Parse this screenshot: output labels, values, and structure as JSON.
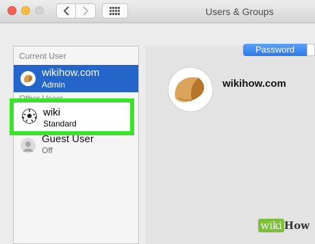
{
  "window": {
    "title": "Users & Groups"
  },
  "sidebar": {
    "current_user_header": "Current User",
    "other_users_header": "Other Users",
    "current_user": {
      "name": "wikihow.com",
      "role": "Admin"
    },
    "users": [
      {
        "name": "wiki",
        "role": "Standard"
      },
      {
        "name": "Guest User",
        "role": "Off"
      }
    ]
  },
  "main": {
    "tab_password": "Password",
    "selected_user_name": "wikihow.com"
  },
  "watermark": {
    "part1": "wiki",
    "part2": "How"
  },
  "colors": {
    "selection": "#2465c9",
    "highlight_box": "#3ae22b",
    "tab_active": "#3b86f0"
  },
  "icons": [
    "back-chevron-icon",
    "forward-chevron-icon",
    "grid-icon",
    "fortune-cookie-icon",
    "soccer-ball-icon",
    "guest-user-icon"
  ]
}
